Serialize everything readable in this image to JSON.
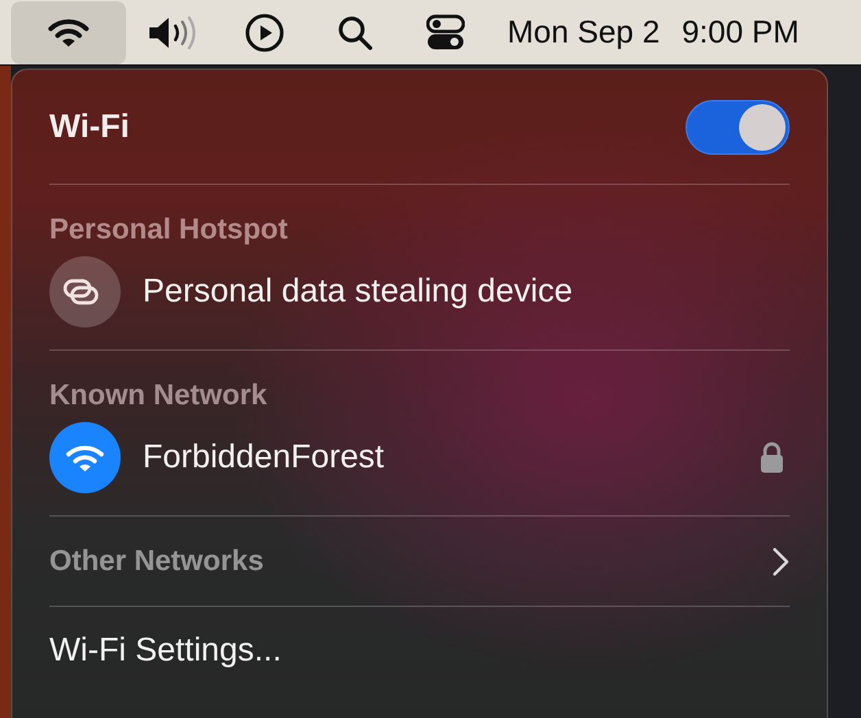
{
  "menu_bar": {
    "items": [
      {
        "kind": "wifi",
        "selected": true
      },
      {
        "kind": "volume",
        "selected": false
      },
      {
        "kind": "play",
        "selected": false
      },
      {
        "kind": "search",
        "selected": false
      },
      {
        "kind": "control",
        "selected": false
      }
    ],
    "date": "Mon Sep 2",
    "time": "9:00 PM"
  },
  "panel": {
    "title": "Wi-Fi",
    "toggle": {
      "on": true
    },
    "sections": [
      {
        "kind": "list",
        "heading": "Personal Hotspot",
        "networks": [
          {
            "name": "Personal data stealing device",
            "kind": "hotspot",
            "connected": false,
            "locked": false
          }
        ]
      },
      {
        "kind": "list",
        "heading": "Known Network",
        "networks": [
          {
            "name": "ForbiddenForest",
            "kind": "wifi",
            "connected": true,
            "locked": true
          }
        ]
      },
      {
        "kind": "submenu",
        "heading": "Other Networks"
      }
    ],
    "settings_link": "Wi-Fi Settings..."
  }
}
